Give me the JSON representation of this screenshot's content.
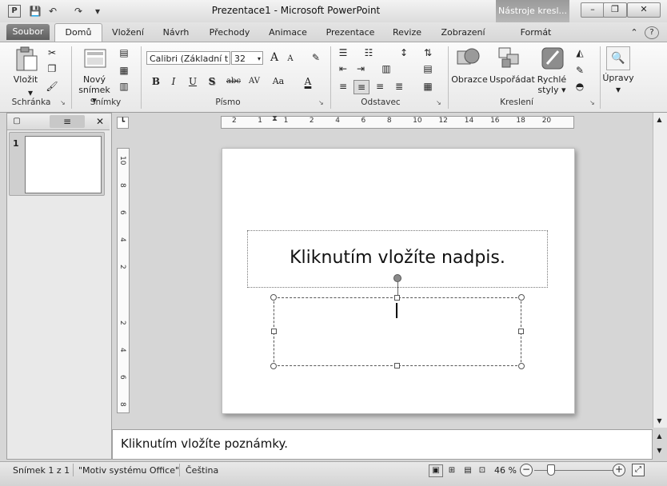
{
  "window": {
    "title": "Prezentace1 - Microsoft PowerPoint",
    "context_tab_group": "Nástroje kresl...",
    "minimize": "–",
    "restore": "❐",
    "close": "✕"
  },
  "quick_access": {
    "app_icon": "P",
    "save": "💾",
    "undo": "↶",
    "redo": "↷",
    "customize": "▾"
  },
  "tabs": [
    {
      "label": "Soubor"
    },
    {
      "label": "Domů"
    },
    {
      "label": "Vložení"
    },
    {
      "label": "Návrh"
    },
    {
      "label": "Přechody"
    },
    {
      "label": "Animace"
    },
    {
      "label": "Prezentace"
    },
    {
      "label": "Revize"
    },
    {
      "label": "Zobrazení"
    },
    {
      "label": "Formát"
    }
  ],
  "ribbon_help": "?",
  "ribbon_min": "⌃",
  "ribbon": {
    "clipboard": {
      "label": "Schránka",
      "paste": "Vložit"
    },
    "slides": {
      "label": "Snímky",
      "new_slide_1": "Nový",
      "new_slide_2": "snímek ▾"
    },
    "font": {
      "label": "Písmo",
      "font_name": "Calibri (Základní t",
      "font_size": "32",
      "grow": "A",
      "shrink": "A",
      "clear": "✎",
      "bold": "B",
      "italic": "I",
      "underline": "U",
      "shadow": "S",
      "strike": "abc",
      "spacing": "AV",
      "case": "Aa",
      "color": "A"
    },
    "paragraph": {
      "label": "Odstavec"
    },
    "drawing": {
      "label": "Kreslení",
      "shapes": "Obrazce",
      "arrange": "Uspořádat",
      "quick_styles_1": "Rychlé",
      "quick_styles_2": "styly ▾"
    },
    "editing": {
      "label": "Úpravy"
    }
  },
  "slide_panel": {
    "tab_slides_icon": "▢",
    "tab_outline_icon": "≡",
    "close": "✕",
    "slide_number": "1"
  },
  "rulers": {
    "horizontal": [
      "2",
      "1",
      "1",
      "2",
      "4",
      "6",
      "8",
      "10",
      "12",
      "14",
      "16",
      "18",
      "20"
    ],
    "vertical_top": [
      "10",
      "8",
      "6",
      "4",
      "2"
    ],
    "vertical_bottom": [
      "2",
      "4",
      "6",
      "8"
    ]
  },
  "slide": {
    "title_placeholder": "Kliknutím vložíte nadpis."
  },
  "notes": {
    "placeholder": "Kliknutím vložíte poznámky."
  },
  "status": {
    "slide": "Snímek 1 z 1",
    "theme": "\"Motiv systému Office\"",
    "language": "Čeština",
    "zoom": "46 %",
    "zoom_out": "−",
    "zoom_in": "+"
  },
  "colors": {
    "file_tab": "#6e6e6e",
    "context_tab": "#a6a6a6",
    "ribbon": "#f2f2f2"
  }
}
